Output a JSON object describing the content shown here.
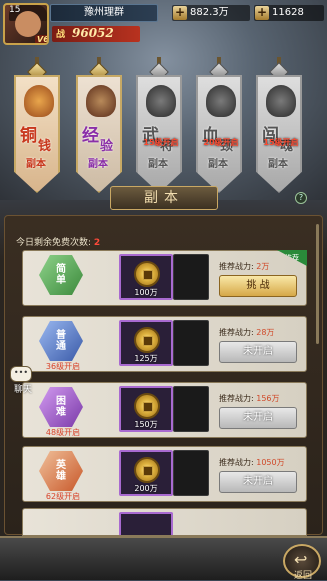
{
  "player": {
    "level": "15",
    "vip": "V6",
    "name": "豫州理群",
    "power_label": "战",
    "power": "96052"
  },
  "resources": {
    "coins": "882.3万",
    "gold": "11628"
  },
  "cards": [
    {
      "line1": "铜",
      "line2": "钱",
      "line3": "副本",
      "lock": ""
    },
    {
      "line1": "经",
      "line2": "验",
      "line3": "副本",
      "lock": ""
    },
    {
      "line1": "武",
      "line2": "将",
      "line3": "副本",
      "lock": "15级开启"
    },
    {
      "line1": "血",
      "line2": "颈",
      "line3": "副本",
      "lock": "20级开启"
    },
    {
      "line1": "闯",
      "line2": "魂",
      "line3": "副本",
      "lock": "15级开启"
    }
  ],
  "section_title": "副本",
  "free_label": "今日剩余免费次数:",
  "free_count": "2",
  "rows": [
    {
      "tier_a": "简",
      "tier_b": "单",
      "unlock": "",
      "reward": "100万",
      "rec_label": "推荐战力:",
      "rec_value": "2万",
      "button": "挑 战",
      "badge": "推荐"
    },
    {
      "tier_a": "普",
      "tier_b": "通",
      "unlock": "36级开启",
      "reward": "125万",
      "rec_label": "推荐战力:",
      "rec_value": "28万",
      "button": "未开启"
    },
    {
      "tier_a": "困",
      "tier_b": "难",
      "unlock": "48级开启",
      "reward": "150万",
      "rec_label": "推荐战力:",
      "rec_value": "156万",
      "button": "未开启"
    },
    {
      "tier_a": "英",
      "tier_b": "雄",
      "unlock": "62级开启",
      "reward": "200万",
      "rec_label": "推荐战力:",
      "rec_value": "1050万",
      "button": "未开启"
    }
  ],
  "chat_label": "聊天",
  "chat_icon": "•••",
  "back_label": "返回"
}
